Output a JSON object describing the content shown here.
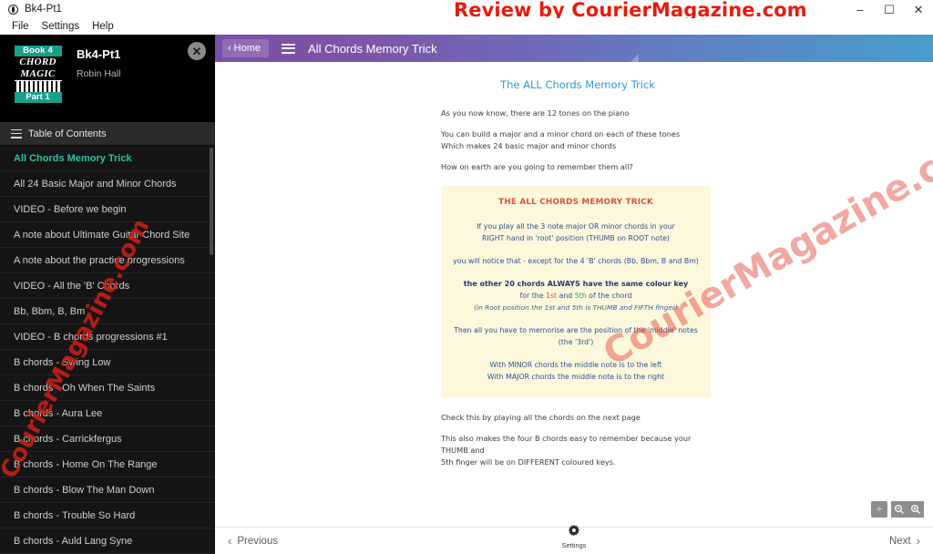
{
  "window": {
    "app_icon": "book-icon",
    "title": "Bk4-Pt1",
    "watermark": "Review by CourierMagazine.com",
    "minimize": "–",
    "maximize": "☐",
    "close": "✕"
  },
  "menubar": {
    "items": [
      {
        "label": "File"
      },
      {
        "label": "Settings"
      },
      {
        "label": "Help"
      }
    ]
  },
  "sidebar": {
    "cover": {
      "book": "Book 4",
      "chord": "CHORD",
      "magic": "MAGIC",
      "part": "Part 1"
    },
    "book_title": "Bk4-Pt1",
    "author": "Robin Hall",
    "close_label": "✕",
    "toc_label": "Table of Contents",
    "items": [
      {
        "label": "All Chords Memory Trick",
        "active": true
      },
      {
        "label": "All 24 Basic Major and Minor Chords",
        "active": false
      },
      {
        "label": "VIDEO - Before we begin",
        "active": false
      },
      {
        "label": "A note about Ultimate Guitar Chord Site",
        "active": false
      },
      {
        "label": "A note about the practice progressions",
        "active": false
      },
      {
        "label": "VIDEO - All the 'B' Chords",
        "active": false
      },
      {
        "label": "Bb, Bbm, B, Bm",
        "active": false
      },
      {
        "label": "VIDEO - B chords progressions #1",
        "active": false
      },
      {
        "label": "B chords - Swing Low",
        "active": false
      },
      {
        "label": "B chords - Oh When The Saints",
        "active": false
      },
      {
        "label": "B chords - Aura Lee",
        "active": false
      },
      {
        "label": "B chords - Carrickfergus",
        "active": false
      },
      {
        "label": "B chords - Home On The Range",
        "active": false
      },
      {
        "label": "B chords - Blow The Man Down",
        "active": false
      },
      {
        "label": "B chords - Trouble So Hard",
        "active": false
      },
      {
        "label": "B chords - Auld Lang Syne",
        "active": false
      }
    ],
    "watermark": "CourierMagazine.com"
  },
  "topbar": {
    "home_label": "Home",
    "home_chevron": "‹",
    "menu_icon": "hamburger-icon",
    "title": "All Chords Memory Trick",
    "gradient_start": "#7a4fa6",
    "gradient_end": "#479dc9"
  },
  "document": {
    "title": "The ALL Chords Memory Trick",
    "paragraphs_before": [
      "As you now know, there are 12 tones on the piano",
      "You can build a major and a minor chord on each of these tones\nWhich makes 24 basic major and minor chords",
      "How on earth are you going to remember them all?"
    ],
    "callout": {
      "title": "THE ALL CHORDS MEMORY TRICK",
      "line1a": "If you play all the 3 note major OR minor chords in your",
      "line1b": "RIGHT hand in 'root' position (THUMB on ROOT note)",
      "line2": "you will notice that - except for the 4 'B' chords (Bb, Bbm, B and Bm)",
      "line3_bold": "the other 20 chords ALWAYS have the same colour key",
      "line4_pre": "for the ",
      "line4_1st": "1st",
      "line4_mid": " and ",
      "line4_5th": "5th",
      "line4_post": " of the chord",
      "line5_italic": "(in Root position the 1st and 5th is THUMB and FIFTH finger)",
      "line6": "Then all you have to memorise are the position of the 'middle' notes",
      "line7": "(the '3rd')",
      "line8": "With MINOR chords the middle note is to the left",
      "line9": "With MAJOR chords the middle note is to the right",
      "background": "#fdf8dc",
      "title_color": "#e0523c",
      "text_color": "#2f4f8f"
    },
    "paragraphs_after": [
      "Check this by playing all the chords on the next page",
      "This also makes the four B chords easy to remember because your THUMB and\n5th finger will be on DIFFERENT coloured keys."
    ],
    "watermark": "CourierMagazine.com"
  },
  "zoom_controls": {
    "fit_label": "÷",
    "zoom_out_label": "−",
    "zoom_in_label": "+"
  },
  "bottombar": {
    "previous_label": "Previous",
    "previous_chevron": "‹",
    "next_label": "Next",
    "next_chevron": "›",
    "settings_label": "Settings",
    "settings_icon": "gear-icon"
  }
}
